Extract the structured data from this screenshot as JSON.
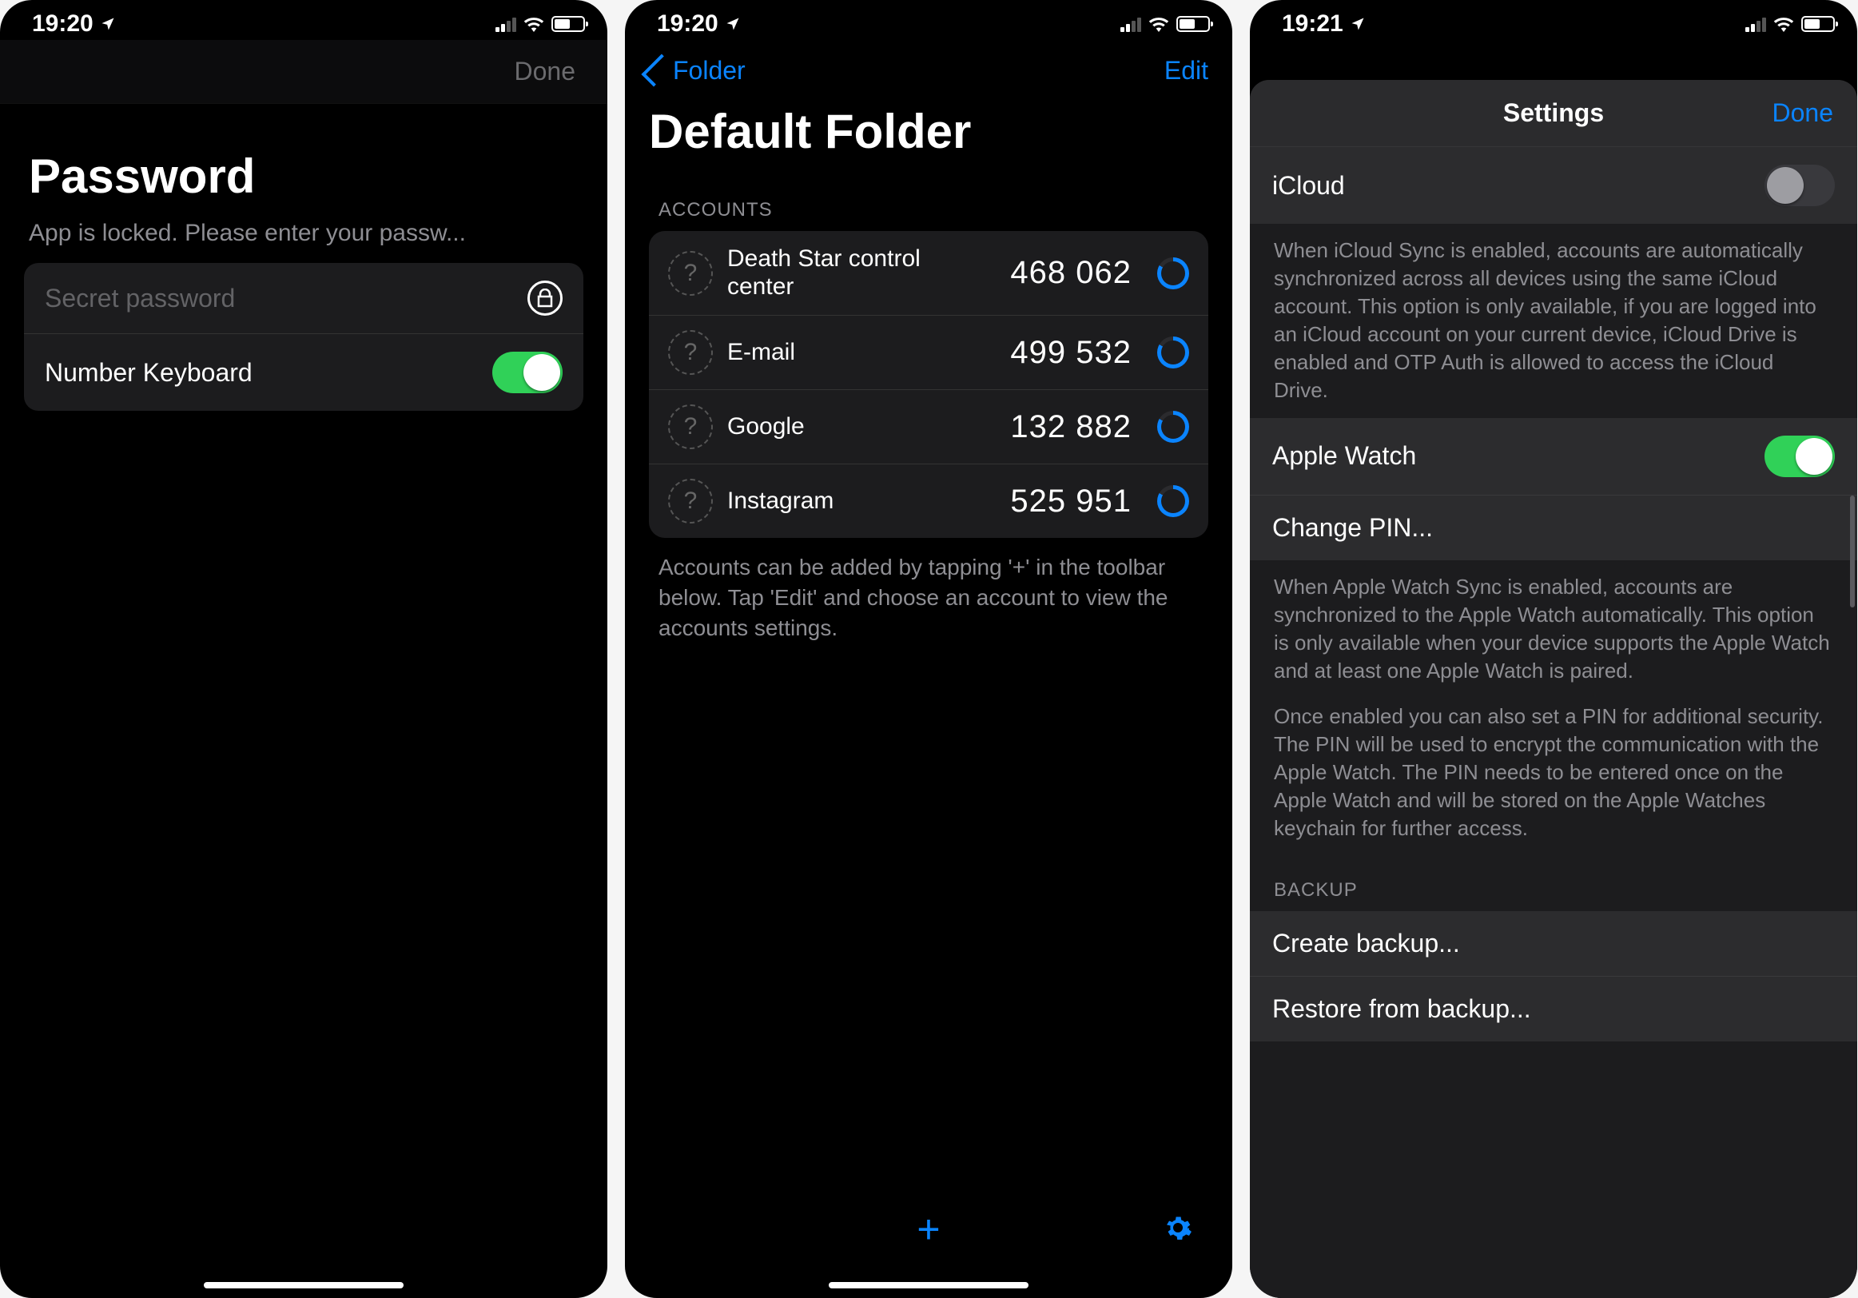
{
  "screen1": {
    "time": "19:20",
    "nav_done": "Done",
    "title": "Password",
    "subtitle": "App is locked. Please enter your passw...",
    "placeholder": "Secret password",
    "number_keyboard_label": "Number Keyboard",
    "number_keyboard_on": true
  },
  "screen2": {
    "time": "19:20",
    "back_label": "Folder",
    "edit_label": "Edit",
    "title": "Default Folder",
    "section_header": "ACCOUNTS",
    "accounts": [
      {
        "name": "Death Star control center",
        "code": "468 062"
      },
      {
        "name": "E-mail",
        "code": "499 532"
      },
      {
        "name": "Google",
        "code": "132 882"
      },
      {
        "name": "Instagram",
        "code": "525 951"
      }
    ],
    "footer": "Accounts can be added by tapping '+' in the toolbar below. Tap 'Edit' and choose an account to view the accounts settings."
  },
  "screen3": {
    "time": "19:21",
    "title": "Settings",
    "done": "Done",
    "icloud_label": "iCloud",
    "icloud_on": false,
    "icloud_desc": "When iCloud Sync is enabled, accounts are automatically synchronized across all devices using the same iCloud account. This option is only available, if you are logged into an iCloud account on your current device, iCloud Drive is enabled and OTP Auth is allowed to access the iCloud Drive.",
    "apple_watch_label": "Apple Watch",
    "apple_watch_on": true,
    "change_pin_label": "Change PIN...",
    "watch_desc1": "When Apple Watch Sync is enabled, accounts are synchronized to the Apple Watch automatically. This option is only available when your device supports the Apple Watch and at least one Apple Watch is paired.",
    "watch_desc2": "Once enabled you can also set a PIN for additional security. The PIN will be used to encrypt the communication with the Apple Watch. The PIN needs to be entered once on the Apple Watch and will be stored on the Apple Watches keychain for further access.",
    "backup_header": "BACKUP",
    "create_backup": "Create backup...",
    "restore_backup": "Restore from backup..."
  }
}
